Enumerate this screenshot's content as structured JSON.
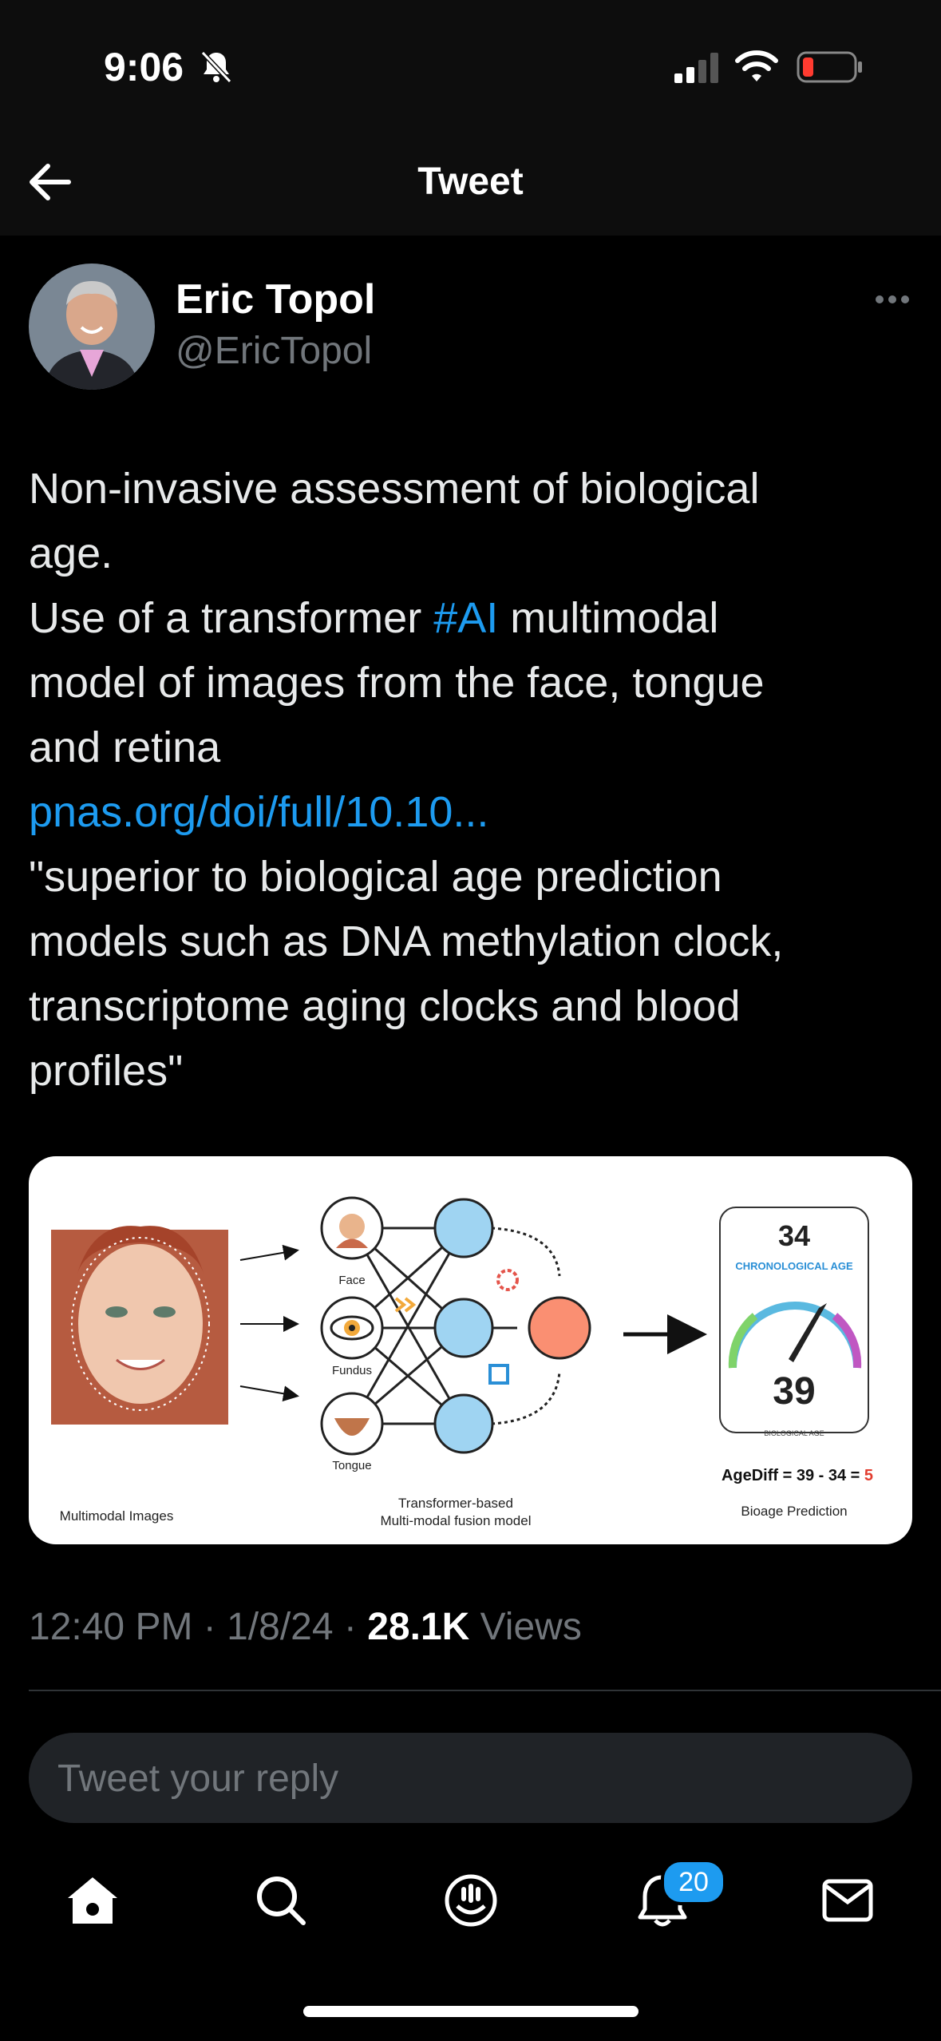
{
  "status_bar": {
    "time": "9:06"
  },
  "header": {
    "title": "Tweet"
  },
  "tweet": {
    "author_name": "Eric Topol",
    "author_handle": "@EricTopol",
    "text": {
      "line1": "Non-invasive assessment of biological",
      "line2": "age.",
      "line3_before": "Use of a transformer ",
      "line3_hashtag": "#AI",
      "line3_after": " multimodal",
      "line4": "model of images from the face, tongue",
      "line5": "and retina",
      "link": "pnas.org/doi/full/10.10...",
      "line7": "\"superior to biological age prediction",
      "line8": "models such as DNA methylation clock,",
      "line9": "transcriptome aging clocks and blood",
      "line10": "profiles\""
    },
    "media": {
      "face_label": "Face",
      "fundus_label": "Fundus",
      "tongue_label": "Tongue",
      "multimodal_images": "Multimodal Images",
      "fusion_line1": "Transformer-based",
      "fusion_line2": "Multi-modal fusion model",
      "chronological_age_value": "34",
      "chronological_age_label": "CHRONOLOGICAL AGE",
      "biological_age_value": "39",
      "biological_age_label": "BIOLOGICAL AGE",
      "agediff_text": "AgeDiff = 39 - 34 = ",
      "agediff_result": "5",
      "bioage_prediction": "Bioage Prediction"
    },
    "time": "12:40 PM",
    "date": "1/8/24",
    "views_count": "28.1K",
    "views_label": "Views"
  },
  "reply": {
    "placeholder": "Tweet your reply"
  },
  "bottom_nav": {
    "notifications_badge": "20"
  },
  "colors": {
    "accent": "#1d9bf0",
    "background": "#000000",
    "muted": "#71767b",
    "battery_low": "#ff3b30"
  },
  "icons": [
    "back-arrow-icon",
    "more-icon",
    "home-icon",
    "search-icon",
    "spaces-icon",
    "notifications-icon",
    "messages-icon",
    "bell-muted-icon",
    "signal-icon",
    "wifi-icon",
    "battery-icon"
  ]
}
